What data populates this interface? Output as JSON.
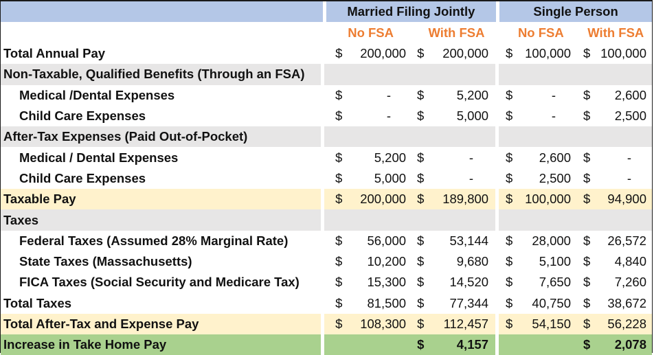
{
  "header": {
    "groups": [
      "Married Filing Jointly",
      "Single Person"
    ],
    "subheaders": [
      "No FSA",
      "With FSA",
      "No FSA",
      "With FSA"
    ]
  },
  "colors": {
    "header_blue": "#b4c7e7",
    "section_gray": "#e7e6e6",
    "highlight_tan": "#fff2cc",
    "result_green": "#a9d18e",
    "subheader_orange": "#ed7d31"
  },
  "rows": [
    {
      "label": "Total Annual Pay",
      "style": "plain",
      "indent": false,
      "values": [
        {
          "d": "$",
          "v": "200,000"
        },
        {
          "d": "$",
          "v": "200,000"
        },
        {
          "d": "$",
          "v": "100,000"
        },
        {
          "d": "$",
          "v": "100,000"
        }
      ]
    },
    {
      "label": "Non-Taxable, Qualified Benefits (Through an FSA)",
      "style": "section",
      "indent": false,
      "values": []
    },
    {
      "label": "Medical /Dental Expenses",
      "style": "plain",
      "indent": true,
      "values": [
        {
          "d": "$",
          "v": "-"
        },
        {
          "d": "$",
          "v": "5,200"
        },
        {
          "d": "$",
          "v": "-"
        },
        {
          "d": "$",
          "v": "2,600"
        }
      ]
    },
    {
      "label": "Child Care Expenses",
      "style": "plain",
      "indent": true,
      "values": [
        {
          "d": "$",
          "v": "-"
        },
        {
          "d": "$",
          "v": "5,000"
        },
        {
          "d": "$",
          "v": "-"
        },
        {
          "d": "$",
          "v": "2,500"
        }
      ]
    },
    {
      "label": "After-Tax Expenses (Paid Out-of-Pocket)",
      "style": "section",
      "indent": false,
      "values": []
    },
    {
      "label": "Medical / Dental Expenses",
      "style": "plain",
      "indent": true,
      "values": [
        {
          "d": "$",
          "v": "5,200"
        },
        {
          "d": "$",
          "v": "-"
        },
        {
          "d": "$",
          "v": "2,600"
        },
        {
          "d": "$",
          "v": "-"
        }
      ]
    },
    {
      "label": "Child Care Expenses",
      "style": "plain",
      "indent": true,
      "values": [
        {
          "d": "$",
          "v": "5,000"
        },
        {
          "d": "$",
          "v": "-"
        },
        {
          "d": "$",
          "v": "2,500"
        },
        {
          "d": "$",
          "v": "-"
        }
      ]
    },
    {
      "label": "Taxable Pay",
      "style": "tan",
      "indent": false,
      "values": [
        {
          "d": "$",
          "v": "200,000"
        },
        {
          "d": "$",
          "v": "189,800"
        },
        {
          "d": "$",
          "v": "100,000"
        },
        {
          "d": "$",
          "v": "94,900"
        }
      ]
    },
    {
      "label": "Taxes",
      "style": "section",
      "indent": false,
      "values": []
    },
    {
      "label": "Federal Taxes (Assumed 28% Marginal Rate)",
      "style": "plain",
      "indent": true,
      "values": [
        {
          "d": "$",
          "v": "56,000"
        },
        {
          "d": "$",
          "v": "53,144"
        },
        {
          "d": "$",
          "v": "28,000"
        },
        {
          "d": "$",
          "v": "26,572"
        }
      ]
    },
    {
      "label": "State Taxes (Massachusetts)",
      "style": "plain",
      "indent": true,
      "values": [
        {
          "d": "$",
          "v": "10,200"
        },
        {
          "d": "$",
          "v": "9,680"
        },
        {
          "d": "$",
          "v": "5,100"
        },
        {
          "d": "$",
          "v": "4,840"
        }
      ]
    },
    {
      "label": "FICA Taxes (Social Security and Medicare Tax)",
      "style": "plain",
      "indent": true,
      "values": [
        {
          "d": "$",
          "v": "15,300"
        },
        {
          "d": "$",
          "v": "14,520"
        },
        {
          "d": "$",
          "v": "7,650"
        },
        {
          "d": "$",
          "v": "7,260"
        }
      ]
    },
    {
      "label": "Total Taxes",
      "style": "plain",
      "indent": false,
      "values": [
        {
          "d": "$",
          "v": "81,500"
        },
        {
          "d": "$",
          "v": "77,344"
        },
        {
          "d": "$",
          "v": "40,750"
        },
        {
          "d": "$",
          "v": "38,672"
        }
      ]
    },
    {
      "label": "Total After-Tax and Expense Pay",
      "style": "tan",
      "indent": false,
      "values": [
        {
          "d": "$",
          "v": "108,300"
        },
        {
          "d": "$",
          "v": "112,457"
        },
        {
          "d": "$",
          "v": "54,150"
        },
        {
          "d": "$",
          "v": "56,228"
        }
      ]
    },
    {
      "label": "Increase in Take Home Pay",
      "style": "green",
      "indent": false,
      "bold_values": true,
      "values": [
        {
          "d": "",
          "v": ""
        },
        {
          "d": "$",
          "v": "4,157"
        },
        {
          "d": "",
          "v": ""
        },
        {
          "d": "$",
          "v": "2,078"
        }
      ]
    }
  ]
}
